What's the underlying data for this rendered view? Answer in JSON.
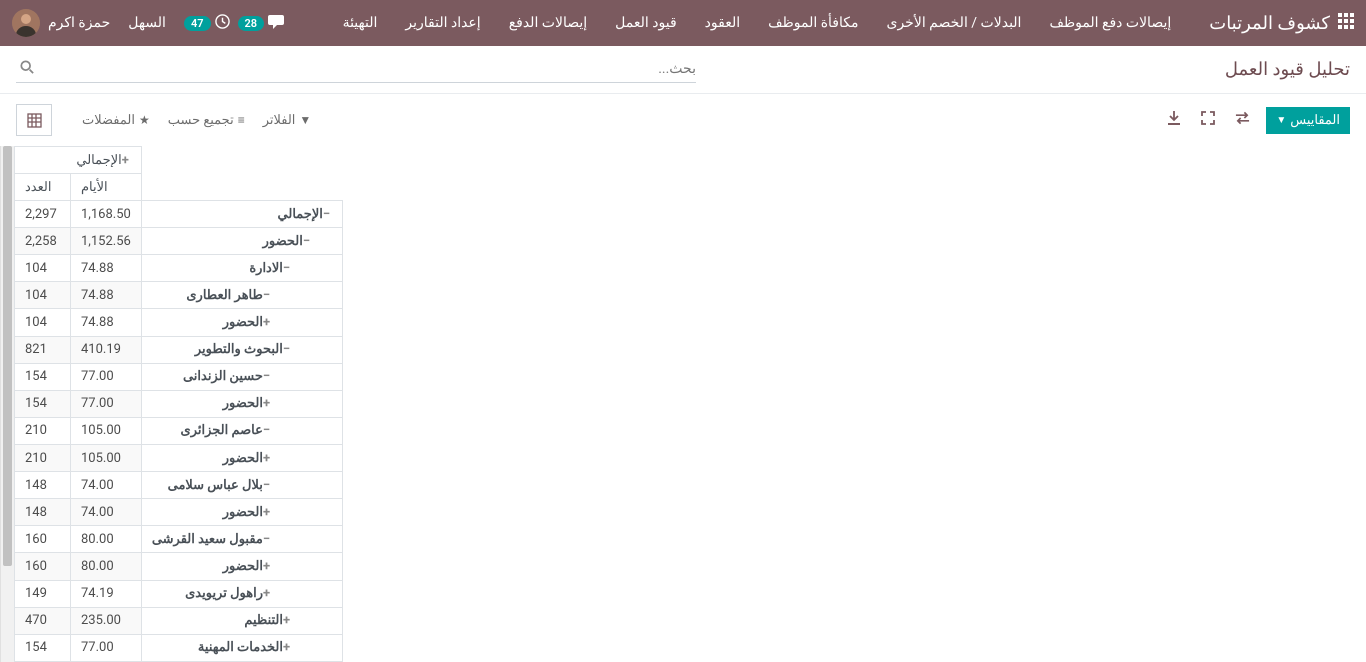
{
  "nav": {
    "appTitle": "كشوف المرتبات",
    "menu": [
      "إيصالات دفع الموظف",
      "البدلات / الخصم الأخرى",
      "مكافأة الموظف",
      "العقود",
      "قيود العمل",
      "إيصالات الدفع",
      "إعداد التقارير",
      "التهيئة"
    ],
    "chatCount": "28",
    "activityCount": "47",
    "companyName": "السهل",
    "userName": "حمزة اكرم"
  },
  "page": {
    "title": "تحليل قيود العمل",
    "searchPlaceholder": "بحث..."
  },
  "toolbar": {
    "measures": "المقاييس",
    "filters": "الفلاتر",
    "groupBy": "تجميع حسب",
    "favorites": "المفضلات"
  },
  "pivot": {
    "header": {
      "total": "الإجمالي",
      "days": "الأيام",
      "count": "العدد"
    },
    "rows": [
      {
        "label": "الإجمالي",
        "icon": "−",
        "indent": 0,
        "days": "1,168.50",
        "count": "2,297"
      },
      {
        "label": "الحضور",
        "icon": "−",
        "indent": 1,
        "days": "1,152.56",
        "count": "2,258"
      },
      {
        "label": "الادارة",
        "icon": "−",
        "indent": 2,
        "days": "74.88",
        "count": "104"
      },
      {
        "label": "طاهر العطارى",
        "icon": "−",
        "indent": 3,
        "days": "74.88",
        "count": "104"
      },
      {
        "label": "الحضور",
        "icon": "+",
        "indent": 3,
        "days": "74.88",
        "count": "104"
      },
      {
        "label": "البحوث والتطوير",
        "icon": "−",
        "indent": 2,
        "days": "410.19",
        "count": "821"
      },
      {
        "label": "حسين الزندانى",
        "icon": "−",
        "indent": 3,
        "days": "77.00",
        "count": "154"
      },
      {
        "label": "الحضور",
        "icon": "+",
        "indent": 3,
        "days": "77.00",
        "count": "154"
      },
      {
        "label": "عاصم الجزائرى",
        "icon": "−",
        "indent": 3,
        "days": "105.00",
        "count": "210"
      },
      {
        "label": "الحضور",
        "icon": "+",
        "indent": 3,
        "days": "105.00",
        "count": "210"
      },
      {
        "label": "بلال عباس سلامى",
        "icon": "−",
        "indent": 3,
        "days": "74.00",
        "count": "148"
      },
      {
        "label": "الحضور",
        "icon": "+",
        "indent": 3,
        "days": "74.00",
        "count": "148"
      },
      {
        "label": "مقبول سعيد القرشى",
        "icon": "−",
        "indent": 3,
        "days": "80.00",
        "count": "160"
      },
      {
        "label": "الحضور",
        "icon": "+",
        "indent": 3,
        "days": "80.00",
        "count": "160"
      },
      {
        "label": "راهول تريويدى",
        "icon": "+",
        "indent": 3,
        "days": "74.19",
        "count": "149"
      },
      {
        "label": "التنظيم",
        "icon": "+",
        "indent": 2,
        "days": "235.00",
        "count": "470"
      },
      {
        "label": "الخدمات المهنية",
        "icon": "+",
        "indent": 2,
        "days": "77.00",
        "count": "154"
      }
    ]
  }
}
